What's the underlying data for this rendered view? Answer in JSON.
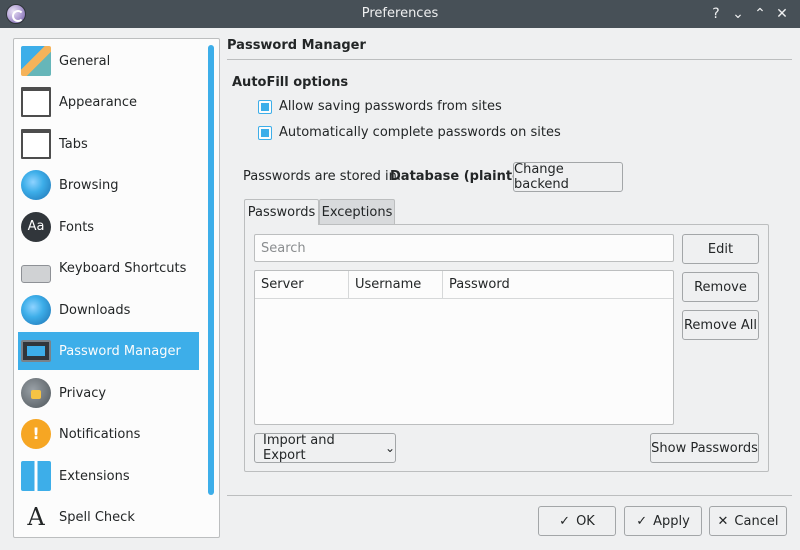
{
  "window": {
    "title": "Preferences",
    "help_glyph": "?",
    "minimize_glyph": "⌄",
    "maximize_glyph": "⌃",
    "close_glyph": "✕"
  },
  "sidebar": {
    "items": [
      {
        "label": "General",
        "icon": "general-icon"
      },
      {
        "label": "Appearance",
        "icon": "appearance-icon"
      },
      {
        "label": "Tabs",
        "icon": "tabs-icon"
      },
      {
        "label": "Browsing",
        "icon": "browsing-globe-icon"
      },
      {
        "label": "Fonts",
        "icon": "fonts-icon",
        "glyph": "Aa"
      },
      {
        "label": "Keyboard Shortcuts",
        "icon": "keyboard-icon"
      },
      {
        "label": "Downloads",
        "icon": "downloads-globe-icon"
      },
      {
        "label": "Password Manager",
        "icon": "monitor-icon",
        "selected": true
      },
      {
        "label": "Privacy",
        "icon": "privacy-lock-icon"
      },
      {
        "label": "Notifications",
        "icon": "notifications-icon",
        "glyph": "!"
      },
      {
        "label": "Extensions",
        "icon": "extensions-icon"
      },
      {
        "label": "Spell Check",
        "icon": "spell-check-icon",
        "glyph": "A"
      }
    ]
  },
  "main": {
    "title": "Password Manager",
    "autofill": {
      "title": "AutoFill options",
      "allow_saving": {
        "label": "Allow saving passwords from sites",
        "checked": true
      },
      "auto_complete": {
        "label": "Automatically complete passwords on sites",
        "checked": true
      }
    },
    "storage": {
      "label": "Passwords are stored in:",
      "value": "Database (plaintext)",
      "change_button": "Change backend"
    },
    "tabs": [
      {
        "label": "Passwords",
        "active": true
      },
      {
        "label": "Exceptions",
        "active": false
      }
    ],
    "search": {
      "placeholder": "Search",
      "value": ""
    },
    "table": {
      "columns": [
        "Server",
        "Username",
        "Password"
      ],
      "rows": []
    },
    "side_buttons": {
      "edit": "Edit",
      "remove": "Remove",
      "remove_all": "Remove All"
    },
    "import_export": {
      "label": "Import and Export",
      "glyph": "⌄"
    },
    "show_passwords": "Show Passwords"
  },
  "dialog_buttons": {
    "ok": {
      "label": "OK",
      "glyph": "✓"
    },
    "apply": {
      "label": "Apply",
      "glyph": "✓"
    },
    "cancel": {
      "label": "Cancel",
      "glyph": "✕"
    }
  },
  "colors": {
    "accent": "#3daee9",
    "titlebar": "#475057",
    "background": "#eff0f1"
  }
}
